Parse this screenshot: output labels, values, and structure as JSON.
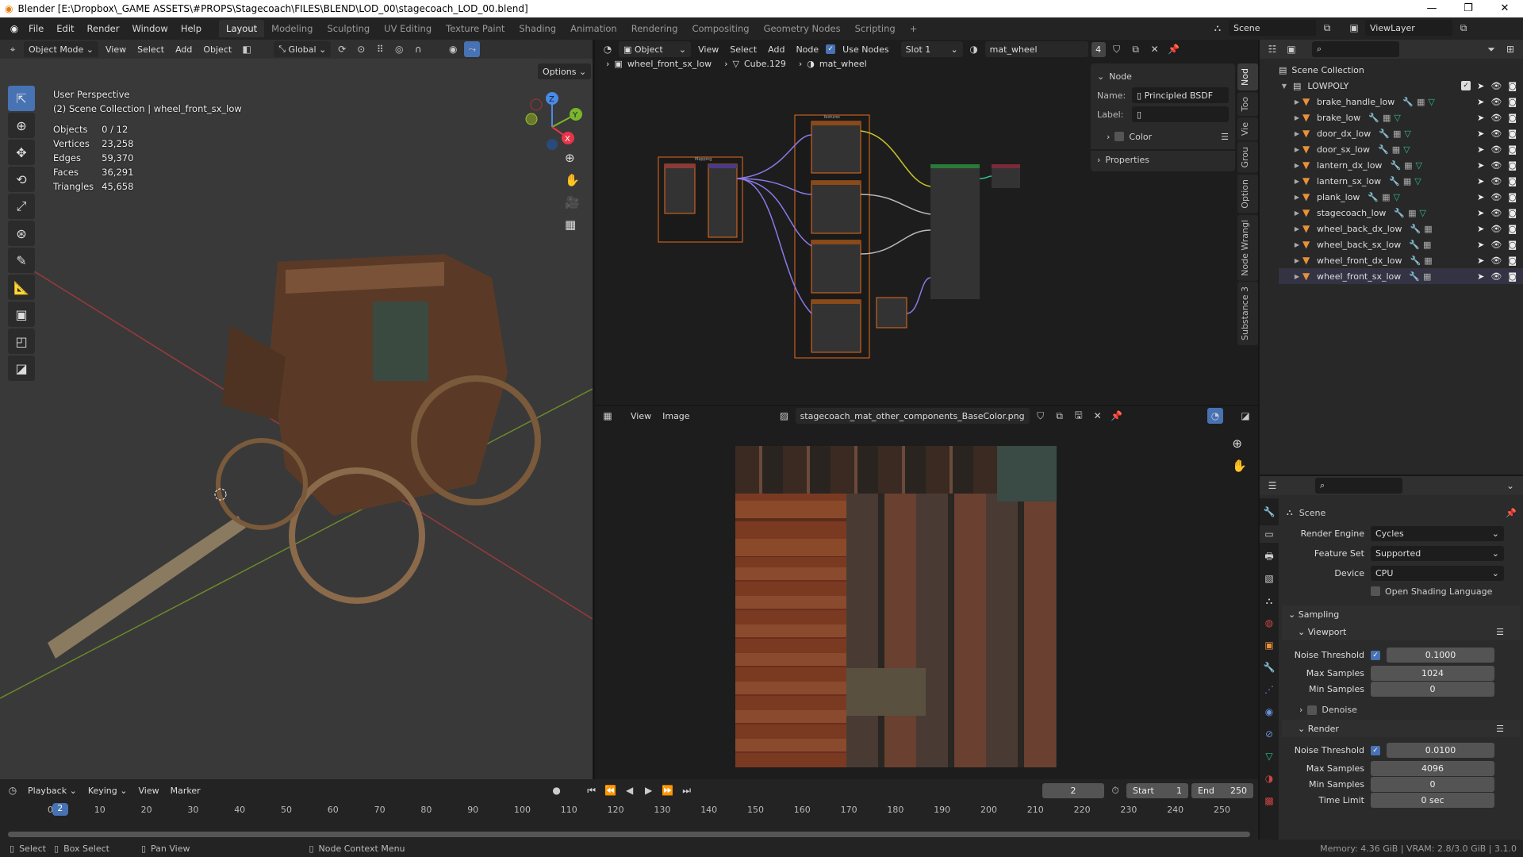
{
  "window": {
    "title": "Blender [E:\\Dropbox\\_GAME ASSETS\\#PROPS\\Stagecoach\\FILES\\BLEND\\LOD_00\\stagecoach_LOD_00.blend]",
    "min": "—",
    "max": "❐",
    "close": "✕"
  },
  "menu": [
    "File",
    "Edit",
    "Render",
    "Window",
    "Help"
  ],
  "workspaces": [
    "Layout",
    "Modeling",
    "Sculpting",
    "UV Editing",
    "Texture Paint",
    "Shading",
    "Animation",
    "Rendering",
    "Compositing",
    "Geometry Nodes",
    "Scripting",
    "+"
  ],
  "scene": {
    "name": "Scene",
    "view_layer": "ViewLayer"
  },
  "viewport_header": {
    "mode": "Object Mode",
    "menus": [
      "View",
      "Select",
      "Add",
      "Object"
    ],
    "transform": "Global",
    "options": "Options"
  },
  "viewport": {
    "perspective": "User Perspective",
    "collection": "(2) Scene Collection | wheel_front_sx_low",
    "stats": [
      {
        "label": "Objects",
        "value": "0 / 12"
      },
      {
        "label": "Vertices",
        "value": "23,258"
      },
      {
        "label": "Edges",
        "value": "59,370"
      },
      {
        "label": "Faces",
        "value": "36,291"
      },
      {
        "label": "Triangles",
        "value": "45,658"
      }
    ],
    "gizmo": {
      "z": "Z",
      "y": "Y",
      "x": "X"
    }
  },
  "node_header": {
    "type": "Object",
    "menus": [
      "View",
      "Select",
      "Add",
      "Node"
    ],
    "use_nodes": "Use Nodes",
    "slot": "Slot 1",
    "material": "mat_wheel",
    "users": "4"
  },
  "breadcrumb": [
    "wheel_front_sx_low",
    "Cube.129",
    "mat_wheel"
  ],
  "node_panel": {
    "title": "Node",
    "name_label": "Name:",
    "name_value": "Principled BSDF",
    "label_label": "Label:",
    "color": "Color",
    "properties": "Properties"
  },
  "node_tabs": [
    "Nod",
    "Too",
    "Vie",
    "Grou",
    "Option",
    "Node Wrangl",
    "Substance 3"
  ],
  "node_frames": [
    "Mapping",
    "Textures"
  ],
  "image_header": {
    "menus": [
      "View",
      "Image"
    ],
    "image": "stagecoach_mat_other_components_BaseColor.png"
  },
  "outliner": {
    "root": "Scene Collection",
    "collection": "LOWPOLY",
    "items": [
      "brake_handle_low",
      "brake_low",
      "door_dx_low",
      "door_sx_low",
      "lantern_dx_low",
      "lantern_sx_low",
      "plank_low",
      "stagecoach_low",
      "wheel_back_dx_low",
      "wheel_back_sx_low",
      "wheel_front_dx_low",
      "wheel_front_sx_low"
    ]
  },
  "properties": {
    "context": "Scene",
    "render_engine": {
      "label": "Render Engine",
      "value": "Cycles"
    },
    "feature_set": {
      "label": "Feature Set",
      "value": "Supported"
    },
    "device": {
      "label": "Device",
      "value": "CPU"
    },
    "osl": "Open Shading Language",
    "sampling": "Sampling",
    "viewport": {
      "title": "Viewport",
      "noise_label": "Noise Threshold",
      "noise": "0.1000",
      "max_label": "Max Samples",
      "max": "1024",
      "min_label": "Min Samples",
      "min": "0"
    },
    "denoise": "Denoise",
    "render": {
      "title": "Render",
      "noise_label": "Noise Threshold",
      "noise": "0.0100",
      "max_label": "Max Samples",
      "max": "4096",
      "min_label": "Min Samples",
      "min": "0",
      "time_label": "Time Limit",
      "time": "0 sec"
    }
  },
  "timeline": {
    "menus": [
      "Playback",
      "Keying",
      "View",
      "Marker"
    ],
    "current": "2",
    "start_label": "Start",
    "start": "1",
    "end_label": "End",
    "end": "250",
    "ticks": [
      "0",
      "10",
      "20",
      "30",
      "40",
      "50",
      "60",
      "70",
      "80",
      "90",
      "100",
      "110",
      "120",
      "130",
      "140",
      "150",
      "160",
      "170",
      "180",
      "190",
      "200",
      "210",
      "220",
      "230",
      "240",
      "250"
    ]
  },
  "status": {
    "select": "Select",
    "box_select": "Box Select",
    "pan": "Pan View",
    "context": "Node Context Menu",
    "memory": "Memory: 4.36 GiB | VRAM: 2.8/3.0 GiB | 3.1.0"
  },
  "colors": {
    "accent": "#4772b3",
    "mesh": "#e8903a",
    "modifier": "#6a8fd8",
    "data": "#2dbf8a"
  }
}
